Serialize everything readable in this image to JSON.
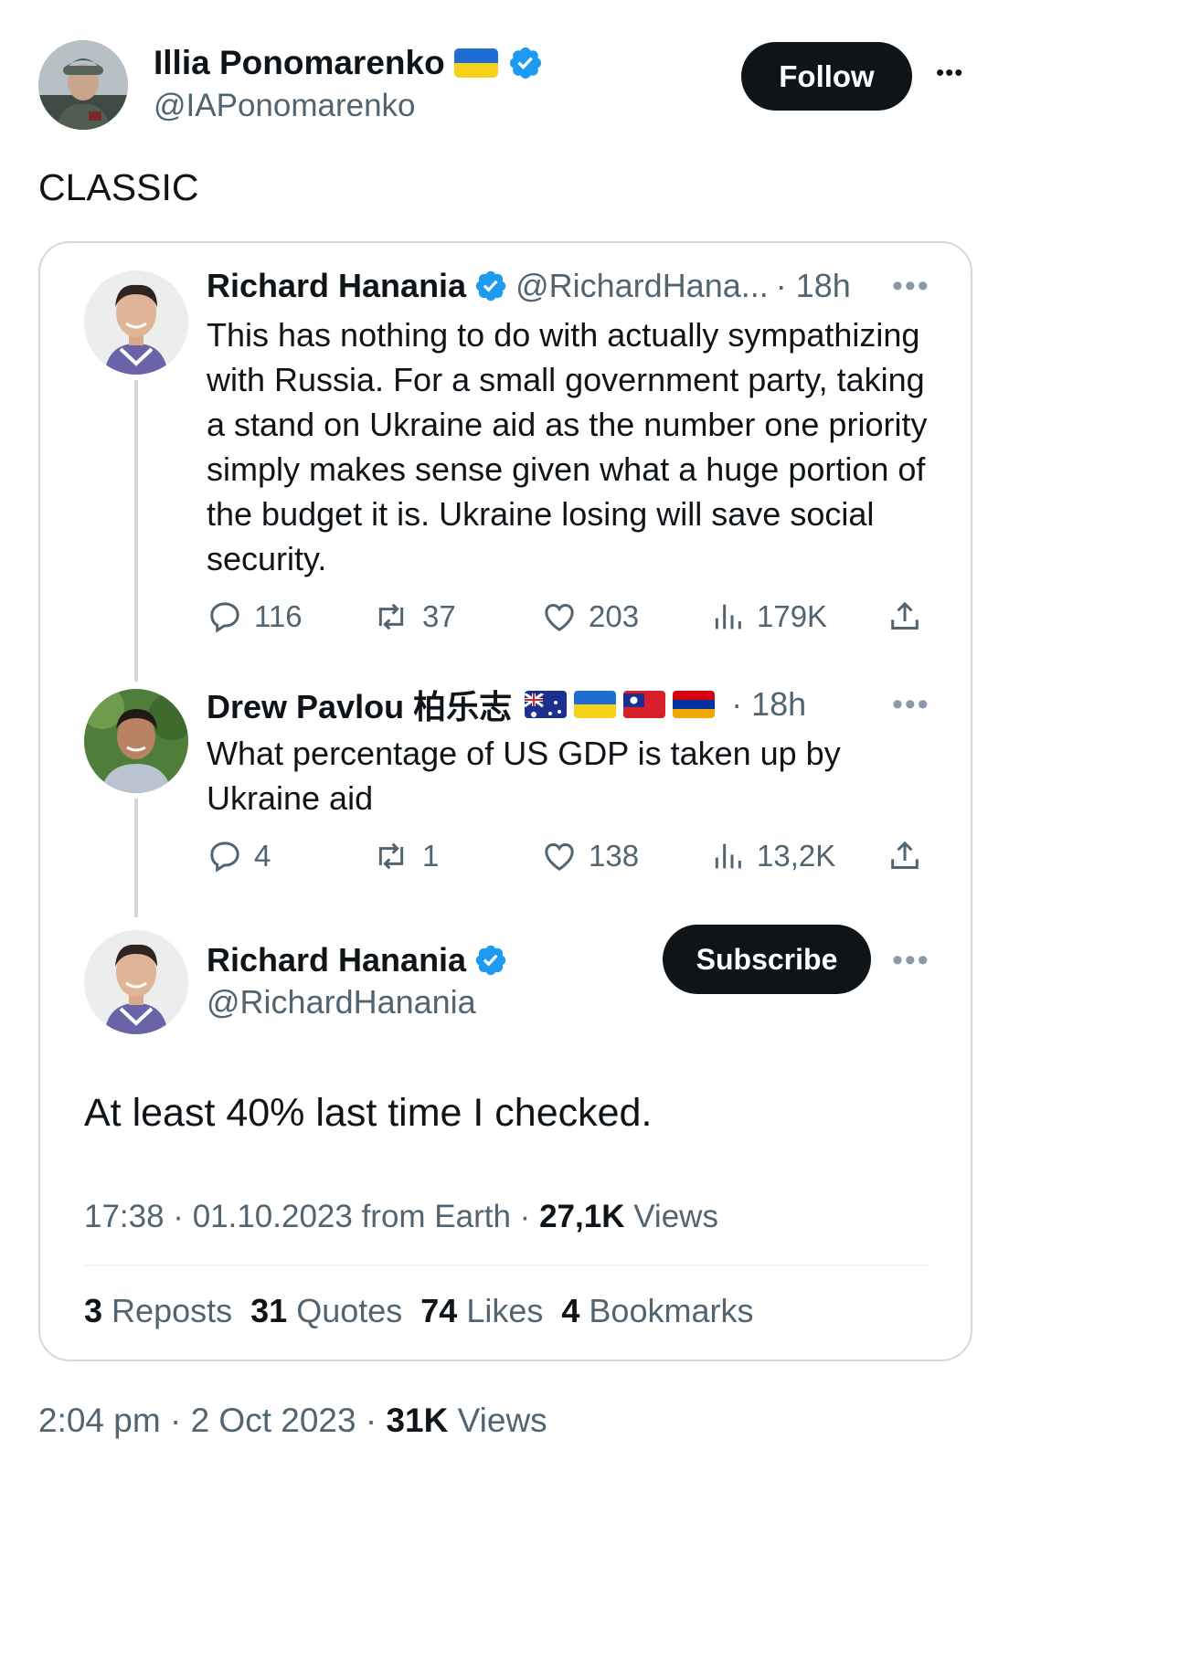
{
  "header": {
    "display_name": "Illia Ponomarenko",
    "handle": "@IAPonomarenko",
    "follow_label": "Follow",
    "more_label": "•••"
  },
  "tweet_text": "CLASSIC",
  "quoted": {
    "t1": {
      "name": "Richard Hanania",
      "handle": "@RichardHana...",
      "time": "· 18h",
      "text": "This has nothing to do with actually sympathizing with Russia. For a small government party, taking a stand on Ukraine aid as the number one priority simply makes sense given what a huge portion of the budget it is. Ukraine losing will save social security.",
      "replies": "116",
      "reposts": "37",
      "likes": "203",
      "views": "179K"
    },
    "t2": {
      "name": "Drew Pavlou 柏乐志",
      "time": "· 18h",
      "text": "What percentage of US GDP is taken up by Ukraine aid",
      "replies": "4",
      "reposts": "1",
      "likes": "138",
      "views": "13,2K"
    },
    "t3": {
      "name": "Richard Hanania",
      "handle": "@RichardHanania",
      "subscribe_label": "Subscribe",
      "text": "At least 40% last time I checked.",
      "meta_prefix": "17:38 · 01.10.2023 from Earth ·",
      "views_num": "27,1K",
      "views_label": "Views",
      "reposts_num": "3",
      "reposts_label": "Reposts",
      "quotes_num": "31",
      "quotes_label": "Quotes",
      "likes_num": "74",
      "likes_label": "Likes",
      "bookmarks_num": "4",
      "bookmarks_label": "Bookmarks"
    }
  },
  "footer": {
    "meta_prefix": "2:04 pm · 2 Oct 2023 ·",
    "views_num": "31K",
    "views_label": "Views"
  },
  "colors": {
    "text": "#0f1419",
    "secondary": "#536471",
    "verified_blue": "#1d9bf0",
    "button_bg": "#0f1419",
    "border": "#cfd9de"
  },
  "icons": [
    "verified-badge-icon",
    "ukraine-flag-icon",
    "australia-flag-icon",
    "taiwan-flag-icon",
    "armenia-flag-icon",
    "reply-icon",
    "repost-icon",
    "like-icon",
    "views-icon",
    "share-icon",
    "more-icon"
  ]
}
